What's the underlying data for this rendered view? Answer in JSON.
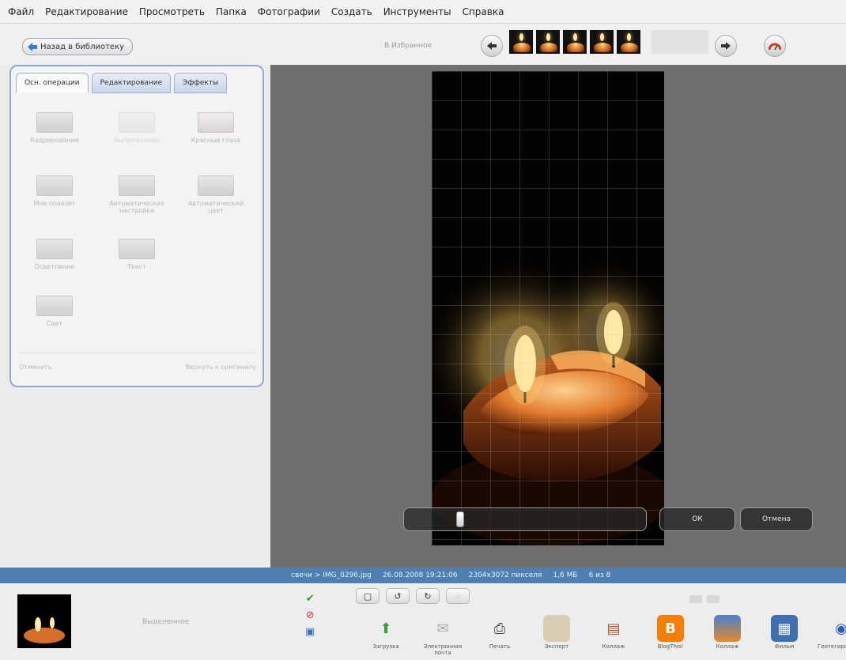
{
  "menu": [
    "Файл",
    "Редактирование",
    "Просмотреть",
    "Папка",
    "Фотографии",
    "Создать",
    "Инструменты",
    "Справка"
  ],
  "toolbar": {
    "back_label": "Назад в библиотеку",
    "fav_label": "В Избранное",
    "prev_icon": "arrow-left-icon",
    "next_icon": "arrow-right-icon"
  },
  "panel": {
    "tabs": [
      "Осн. операции",
      "Редактирование",
      "Эффекты"
    ],
    "tools": [
      "Кадрирование",
      "Выпрямление",
      "Красные глаза",
      "Мне повезёт",
      "Автоматическая настройка",
      "Автоматический цвет",
      "Осветление",
      "Текст",
      "Свет"
    ],
    "undo_label": "Отменить",
    "redo_label": "Вернуть к оригиналу"
  },
  "crop": {
    "ok_label": "ОК",
    "cancel_label": "Отмена"
  },
  "status": {
    "filename": "свечи > IMG_0296.jpg",
    "datetime": "26.08.2008 19:21:06",
    "dimensions": "2304x3072 пикселя",
    "size": "1,6 МБ",
    "counter": "6 из 8"
  },
  "tray": {
    "selection_label": "Выделенное",
    "actions": [
      "Загрузка",
      "Электронная почта",
      "Печать",
      "Экспорт",
      "Коллаж",
      "BlogThis!",
      "Коллаж",
      "Фильм",
      "Геотегирование"
    ]
  },
  "colors": {
    "statusbar": "#4f7fb0",
    "panel_border": "#8fa8cf",
    "canvas_bg": "#6f6f6f"
  }
}
